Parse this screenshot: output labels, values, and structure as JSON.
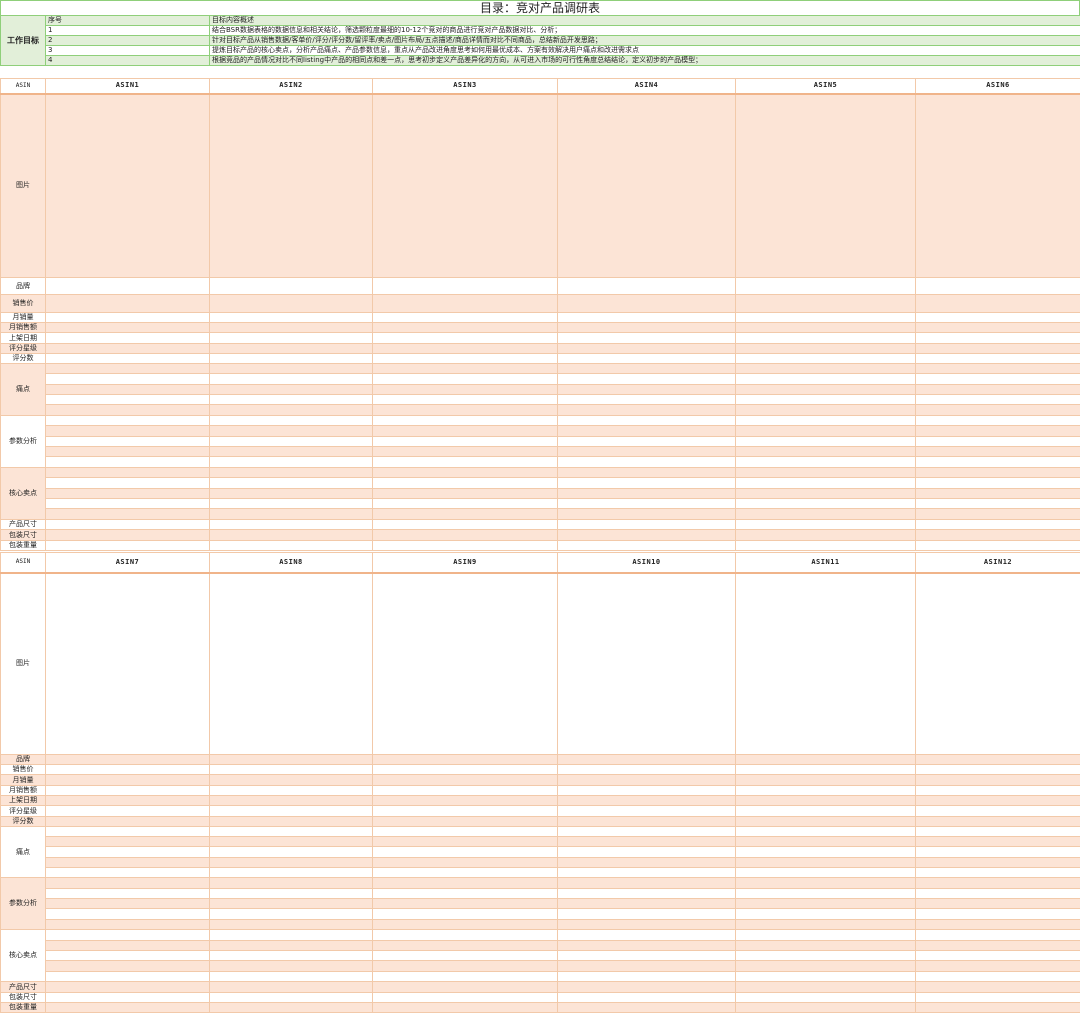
{
  "title": "目录：竞对产品调研表",
  "goals": {
    "label": "工作目标",
    "header": {
      "num": "序号",
      "desc": "目标内容概述"
    },
    "items": [
      {
        "num": "1",
        "text": "结合BSR数据表格的数据信息和相关结论，筛选颗粒度最细的10-12个竞对的商品进行竞对产品数据对比、分析；"
      },
      {
        "num": "2",
        "text": "针对目标产品从销售数据/客单价/评分/评分数/留评率/卖点/图片布局/五点描述/商品详情而对比不同商品，总结新品开发思路；"
      },
      {
        "num": "3",
        "text": "提炼目标产品的核心卖点，分析产品痛点、产品参数信息，重点从产品改进角度思考如何用最优成本、方案有效解决用户痛点和改进需求点"
      },
      {
        "num": "4",
        "text": "根据竞品的产品情况对比不同listing中产品的相同点和差一点，思考初步定义产品差异化的方向，从可进入市场的可行性角度总结结论，定义初步的产品模型；"
      }
    ]
  },
  "row_labels": {
    "asin": "ASIN",
    "image": "图片",
    "brand": "品牌",
    "price": "销售价",
    "monthly_sales": "月销量",
    "monthly_revenue": "月销售额",
    "launch_date": "上架日期",
    "rating": "评分星级",
    "review_count": "评分数",
    "pain_points": "痛点",
    "params": "参数分析",
    "core_points": "核心卖点",
    "product_size": "产品尺寸",
    "package_size": "包装尺寸",
    "package_weight": "包装重量"
  },
  "asins_1": [
    "ASIN1",
    "ASIN2",
    "ASIN3",
    "ASIN4",
    "ASIN5",
    "ASIN6"
  ],
  "asins_2": [
    "ASIN7",
    "ASIN8",
    "ASIN9",
    "ASIN10",
    "ASIN11",
    "ASIN12"
  ],
  "colors": {
    "accent_green": "#8fcf7a",
    "light_green": "#e2efd9",
    "peach": "#fce4d6",
    "peach_border": "#f2c9a9"
  }
}
